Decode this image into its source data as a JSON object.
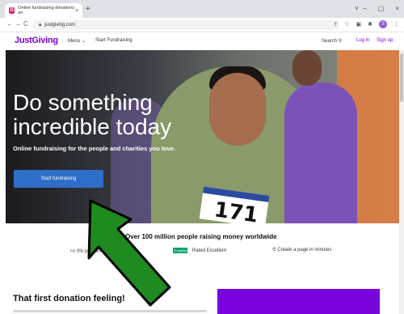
{
  "browser": {
    "tab_title": "Online fundraising donations an",
    "tab_close": "×",
    "new_tab": "+",
    "url": "justgiving.com",
    "nav_back": "←",
    "nav_forward": "→",
    "nav_reload": "C",
    "window_controls": [
      "∨",
      "–",
      "▢",
      "×"
    ],
    "profile_initial": "S"
  },
  "site": {
    "logo": "JustGiving",
    "nav": {
      "menu": "Menu",
      "start_fundraising": "Start Fundraising",
      "search": "Search",
      "login": "Log in",
      "signup": "Sign up"
    }
  },
  "hero": {
    "headline_line1": "Do something",
    "headline_line2": "incredible today",
    "subheadline": "Online fundraising for the people and charities you love.",
    "cta": "Start fundraising",
    "bib_number": "171"
  },
  "stats": {
    "headline": "Over 100 million people raising money worldwide",
    "items": [
      "0% platform fee",
      "Rated Excellent",
      "Create a page in minutes"
    ],
    "trustpilot": "Trustpilot"
  },
  "lower": {
    "heading": "That first donation feeling!"
  },
  "colors": {
    "brand": "#7a04dd",
    "cta": "#2f6ec8",
    "arrow": "#1f8a1f"
  }
}
